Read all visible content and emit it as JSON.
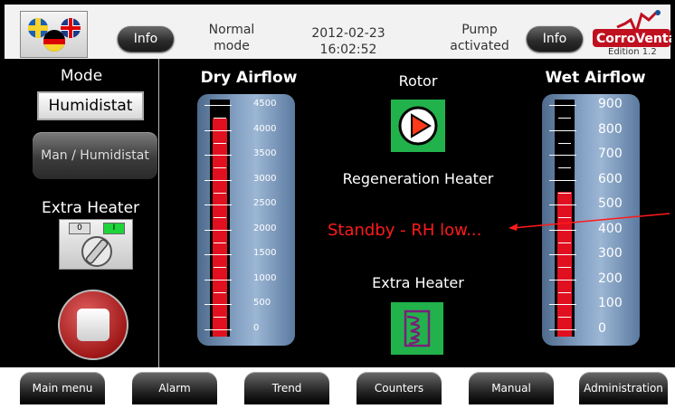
{
  "header": {
    "info_left_label": "Info",
    "mode_line1": "Normal",
    "mode_line2": "mode",
    "date": "2012-02-23",
    "time": "16:02:52",
    "pump_line1": "Pump",
    "pump_line2": "activated",
    "info_right_label": "Info",
    "edition": "Edition 1.2",
    "logo_text": "CorroVenta"
  },
  "left": {
    "mode_label": "Mode",
    "humidistat_label": "Humidistat",
    "man_humidistat_label": "Man / Humidistat",
    "extra_heater_label": "Extra Heater",
    "switch_off": "0",
    "switch_on": "I"
  },
  "dry_airflow": {
    "title": "Dry Airflow",
    "ticks": [
      "4500",
      "4000",
      "3500",
      "3000",
      "2500",
      "2000",
      "1500",
      "1000",
      "500",
      "0"
    ],
    "level": 0.92
  },
  "wet_airflow": {
    "title": "Wet Airflow",
    "ticks": [
      "900",
      "800",
      "700",
      "600",
      "500",
      "400",
      "300",
      "200",
      "100",
      "0"
    ],
    "level": 0.61
  },
  "center": {
    "rotor_label": "Rotor",
    "regen_label": "Regeneration Heater",
    "status": "Standby - RH low...",
    "extra_heater_label": "Extra Heater"
  },
  "nav": [
    "Main menu",
    "Alarm",
    "Trend",
    "Counters",
    "Manual",
    "Administration"
  ],
  "colors": {
    "status_red": "#ff1a1a",
    "fill_red": "#e01020",
    "icon_green": "#22b24c"
  }
}
